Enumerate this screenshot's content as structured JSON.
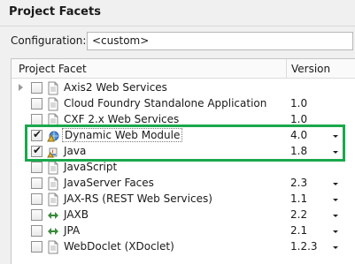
{
  "dialog": {
    "title": "Project Facets"
  },
  "configuration": {
    "label": "Configuration:",
    "value": "<custom>"
  },
  "table": {
    "columns": [
      "Project Facet",
      "Version"
    ],
    "rows": [
      {
        "name": "Axis2 Web Services",
        "version": "",
        "checked": false,
        "expandable": true,
        "icon": "page-icon",
        "dropdown": false
      },
      {
        "name": "Cloud Foundry Standalone Application",
        "version": "1.0",
        "checked": false,
        "expandable": false,
        "icon": "page-icon",
        "dropdown": false
      },
      {
        "name": "CXF 2.x Web Services",
        "version": "1.0",
        "checked": false,
        "expandable": false,
        "icon": "page-icon",
        "dropdown": false
      },
      {
        "name": "Dynamic Web Module",
        "version": "4.0",
        "checked": true,
        "expandable": false,
        "icon": "web-module-icon",
        "dropdown": true,
        "selected": true
      },
      {
        "name": "Java",
        "version": "1.8",
        "checked": true,
        "expandable": false,
        "icon": "java-icon",
        "dropdown": true
      },
      {
        "name": "JavaScript",
        "version": "",
        "checked": false,
        "expandable": false,
        "icon": "page-icon",
        "dropdown": false
      },
      {
        "name": "JavaServer Faces",
        "version": "2.3",
        "checked": false,
        "expandable": false,
        "icon": "page-icon",
        "dropdown": true
      },
      {
        "name": "JAX-RS (REST Web Services)",
        "version": "1.1",
        "checked": false,
        "expandable": false,
        "icon": "page-icon",
        "dropdown": true
      },
      {
        "name": "JAXB",
        "version": "2.2",
        "checked": false,
        "expandable": false,
        "icon": "double-arrow-icon",
        "dropdown": true
      },
      {
        "name": "JPA",
        "version": "2.1",
        "checked": false,
        "expandable": false,
        "icon": "double-arrow-icon",
        "dropdown": true
      },
      {
        "name": "WebDoclet (XDoclet)",
        "version": "1.2.3",
        "checked": false,
        "expandable": false,
        "icon": "page-icon",
        "dropdown": true
      }
    ]
  },
  "colors": {
    "highlight": "#1aa84b"
  }
}
